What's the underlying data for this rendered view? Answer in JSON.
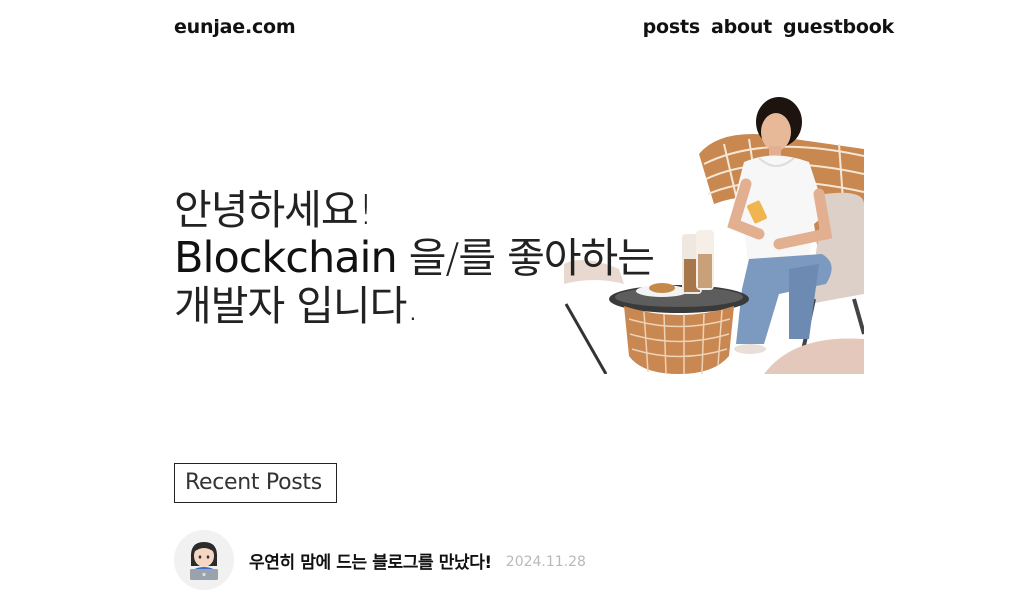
{
  "header": {
    "logo": "eunjae.com",
    "nav": [
      "posts",
      "about",
      "guestbook"
    ]
  },
  "hero": {
    "line1": "안녕하세요!",
    "accent": "Blockchain",
    "line2_rest": " 을/를 좋아하는",
    "line3": "개발자  입니다."
  },
  "recent_posts": {
    "heading": "Recent Posts",
    "items": [
      {
        "title": "우연히 맘에 드는 블로그를 만났다!",
        "date": "2024.11.28",
        "avatar_icon": "woman-technologist-emoji"
      }
    ]
  }
}
